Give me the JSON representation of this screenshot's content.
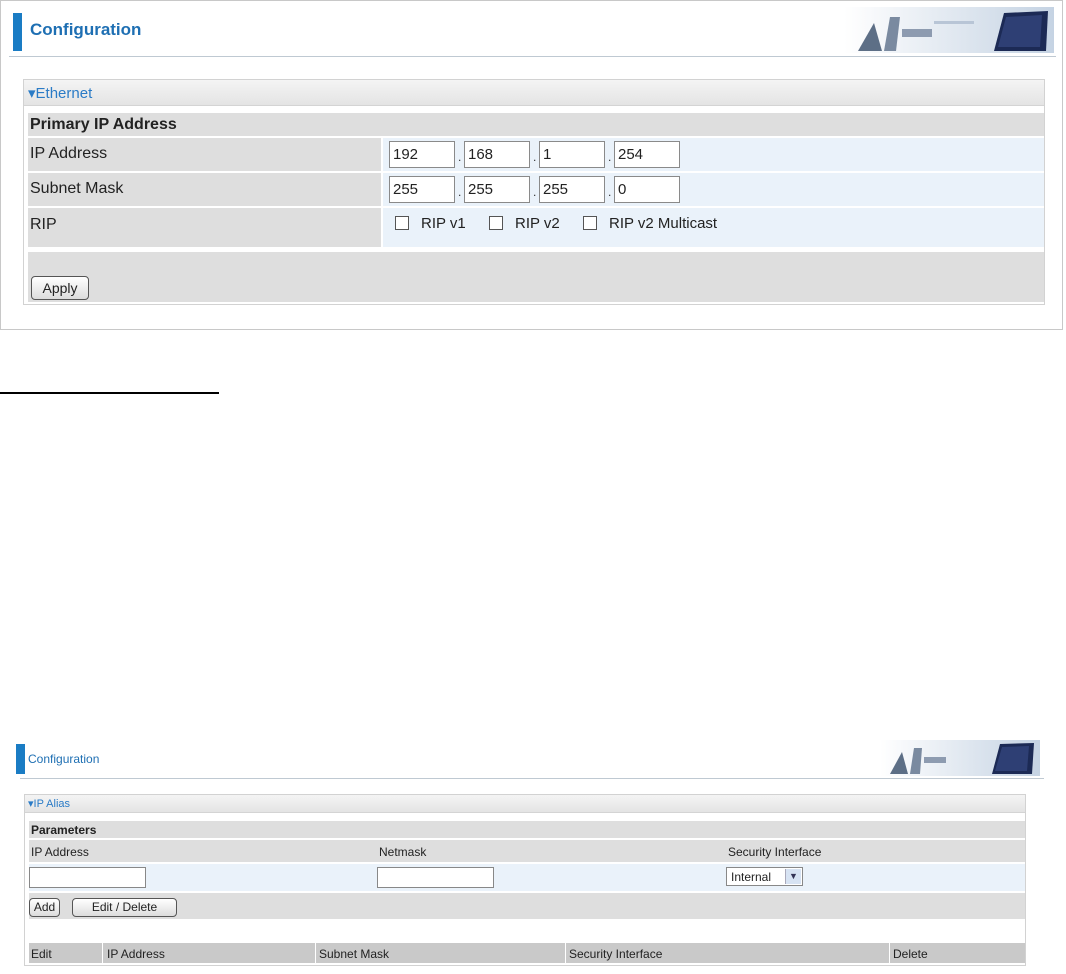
{
  "top": {
    "title": "Configuration",
    "section": "▾Ethernet",
    "group_label": "Primary IP Address",
    "ip_label": "IP Address",
    "ip": [
      "192",
      "168",
      "1",
      "254"
    ],
    "mask_label": "Subnet Mask",
    "mask": [
      "255",
      "255",
      "255",
      "0"
    ],
    "rip_label": "RIP",
    "rip_options": [
      "RIP v1",
      "RIP v2",
      "RIP v2 Multicast"
    ],
    "apply": "Apply"
  },
  "bottom": {
    "title": "Configuration",
    "section": "▾IP Alias",
    "group_label": "Parameters",
    "col_ip": "IP Address",
    "col_netmask": "Netmask",
    "col_security": "Security Interface",
    "security_value": "Internal",
    "add": "Add",
    "edit_delete": "Edit / Delete",
    "table_headers": [
      "Edit",
      "IP Address",
      "Subnet Mask",
      "Security Interface",
      "Delete"
    ]
  },
  "colors": {
    "accent": "#1a7cc4",
    "title": "#1e6fb3",
    "label_bg": "#dedede",
    "value_bg": "#eaf2fa"
  }
}
